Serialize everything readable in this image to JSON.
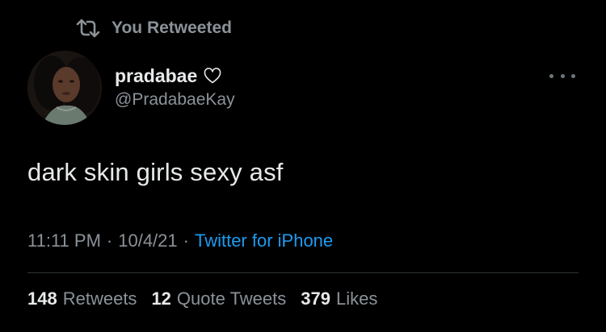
{
  "retweet_header": {
    "icon": "retweet-icon",
    "label": "You Retweeted"
  },
  "author": {
    "display_name": "pradabae",
    "name_icon": "heart-outline-icon",
    "handle": "@PradabaeKay",
    "avatar_icon": "profile-photo"
  },
  "more_icon": "more-horizontal-icon",
  "tweet": {
    "text": "dark skin girls sexy asf"
  },
  "meta": {
    "time": "11:11 PM",
    "separator": "·",
    "date": "10/4/21",
    "source": "Twitter for iPhone"
  },
  "stats": {
    "retweets_count": "148",
    "retweets_label": "Retweets",
    "quotes_count": "12",
    "quotes_label": "Quote Tweets",
    "likes_count": "379",
    "likes_label": "Likes"
  },
  "colors": {
    "background": "#000000",
    "text_primary": "#e7e9ea",
    "text_secondary": "#8b9299",
    "link": "#1d9bf0",
    "divider": "#2f3336"
  }
}
